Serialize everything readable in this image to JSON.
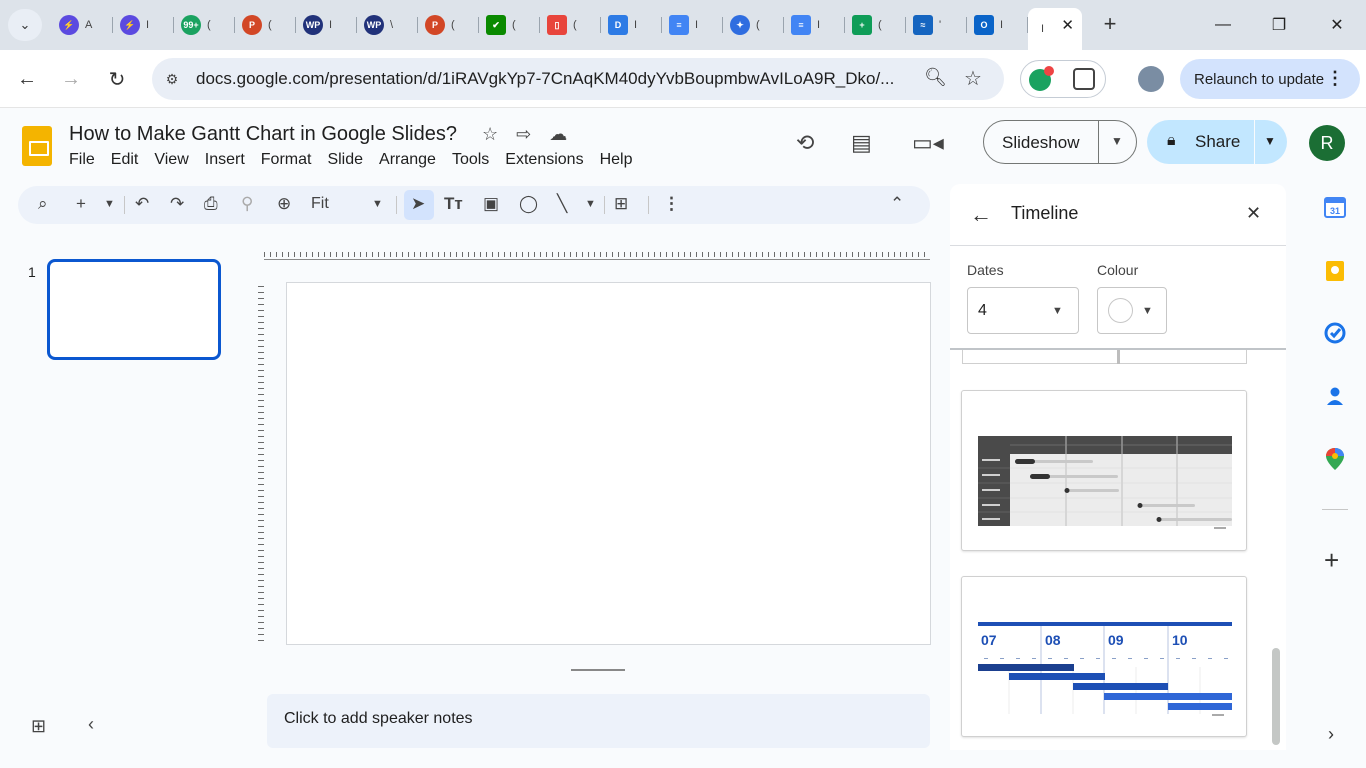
{
  "browser": {
    "tabs": [
      {
        "glyph": "⚡",
        "color": "#5b4ae0",
        "letter": "A"
      },
      {
        "glyph": "⚡",
        "color": "#5b4ae0",
        "letter": "I"
      },
      {
        "glyph": "99+",
        "color": "#1aa260",
        "letter": "("
      },
      {
        "glyph": "P",
        "color": "#d24726",
        "letter": "("
      },
      {
        "glyph": "WP",
        "color": "#21327a",
        "letter": "I"
      },
      {
        "glyph": "WP",
        "color": "#21327a",
        "letter": "\\"
      },
      {
        "glyph": "P",
        "color": "#d24726",
        "letter": "("
      },
      {
        "glyph": "✔",
        "color": "#0a8a00",
        "letter": "("
      },
      {
        "glyph": "▯",
        "color": "#e8453c",
        "letter": "("
      },
      {
        "glyph": "D",
        "color": "#2d7be5",
        "letter": "I"
      },
      {
        "glyph": "≡",
        "color": "#4285f4",
        "letter": "I"
      },
      {
        "glyph": "✦",
        "color": "#2f6de0",
        "letter": "("
      },
      {
        "glyph": "≡",
        "color": "#4285f4",
        "letter": "I"
      },
      {
        "glyph": "+",
        "color": "#0f9d58",
        "letter": "("
      },
      {
        "glyph": "≈",
        "color": "#1565c0",
        "letter": "'"
      },
      {
        "glyph": "O",
        "color": "#0a64c8",
        "letter": "I"
      }
    ],
    "active_tab_letter": "I",
    "url": "docs.google.com/presentation/d/1iRAVgkYp7-7CnAqKM40dyYvbBoupmbwAvILoA9R_Dko/...",
    "relaunch_label": "Relaunch to update"
  },
  "doc": {
    "title": "How to Make Gantt Chart in Google Slides?",
    "menu": [
      "File",
      "Edit",
      "View",
      "Insert",
      "Format",
      "Slide",
      "Arrange",
      "Tools",
      "Extensions",
      "Help"
    ],
    "slideshow_label": "Slideshow",
    "share_label": "Share",
    "avatar_letter": "R",
    "zoom_value": "Fit",
    "slide_number": "1",
    "speaker_notes_placeholder": "Click to add speaker notes"
  },
  "panel": {
    "title": "Timeline",
    "dates_label": "Dates",
    "dates_value": "4",
    "colour_label": "Colour",
    "template2_labels": [
      "07",
      "08",
      "09",
      "10"
    ]
  },
  "colors": {
    "accent": "#0b57d0",
    "share_bg": "#c2e7ff",
    "avatar_bg": "#1b6e34",
    "slides_logo": "#f4b400"
  }
}
